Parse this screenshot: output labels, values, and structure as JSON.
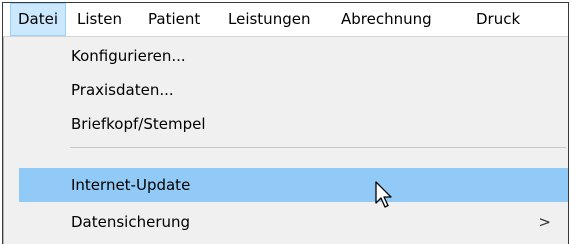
{
  "menubar": {
    "items": [
      {
        "label": "Datei"
      },
      {
        "label": "Listen"
      },
      {
        "label": "Patient"
      },
      {
        "label": "Leistungen"
      },
      {
        "label": "Abrechnung"
      },
      {
        "label": "Druck"
      }
    ]
  },
  "dropdown": {
    "items": [
      {
        "label": "Konfigurieren..."
      },
      {
        "label": "Praxisdaten..."
      },
      {
        "label": "Briefkopf/Stempel"
      },
      {
        "label": "Internet-Update"
      },
      {
        "label": "Datensicherung",
        "submenu_arrow": ">"
      }
    ]
  },
  "cursor": {
    "icon": "mouse-pointer-icon"
  },
  "colors": {
    "highlight": "#91c9f7",
    "open_menu_bg": "#cce8ff",
    "menu_bg": "#f0f0f0"
  }
}
